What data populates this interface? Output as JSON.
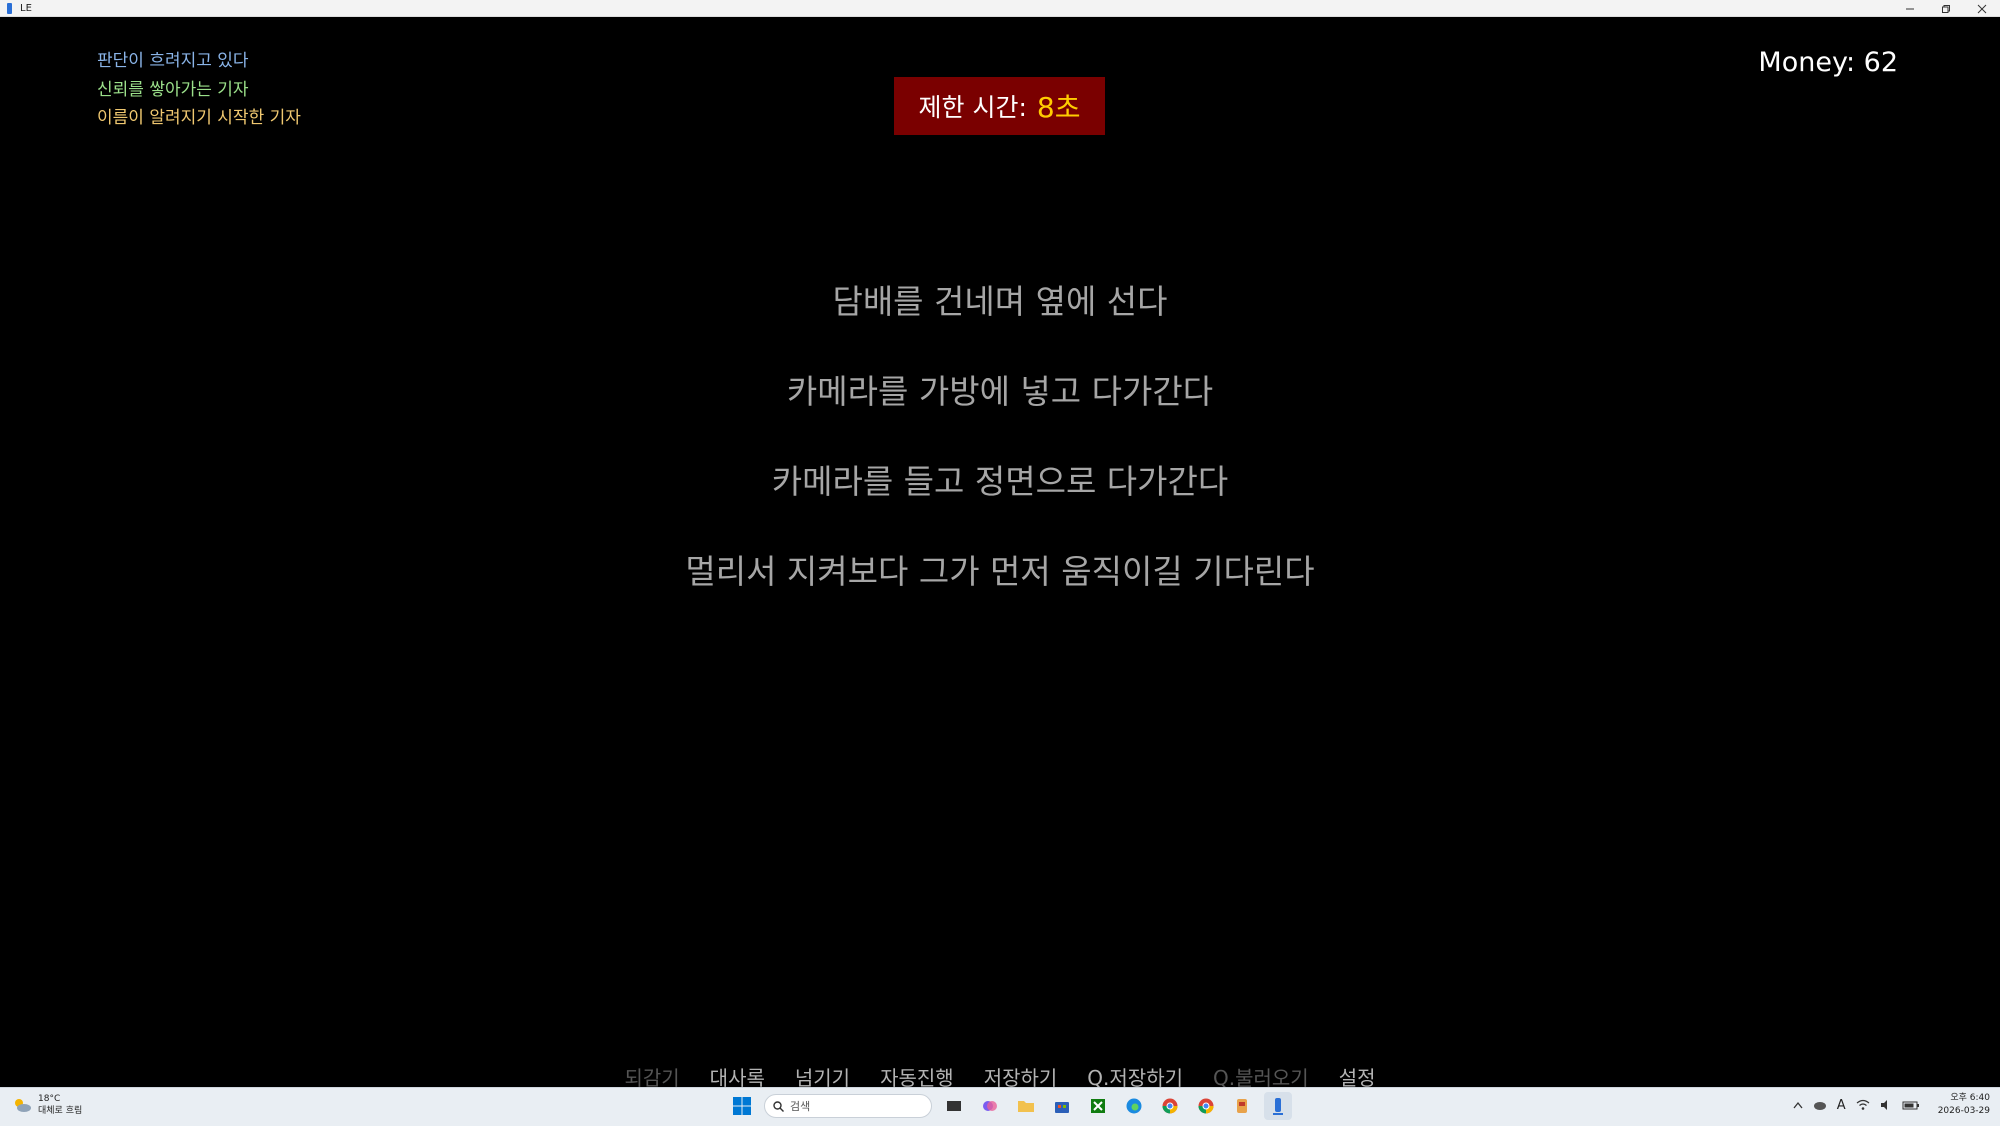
{
  "window": {
    "title": "LE"
  },
  "status_lines": [
    {
      "text": "판단이 흐려지고 있다",
      "color": "#8ab4e8"
    },
    {
      "text": "신뢰를 쌓아가는 기자",
      "color": "#9be08a"
    },
    {
      "text": "이름이 알려지기 시작한 기자",
      "color": "#f0c870"
    }
  ],
  "money": {
    "label": "Money: 62"
  },
  "timer": {
    "label": "제한 시간:",
    "value": "8초"
  },
  "choices": [
    "담배를 건네며 옆에 선다",
    "카메라를 가방에 넣고 다가간다",
    "카메라를 들고 정면으로 다가간다",
    "멀리서 지켜보다 그가 먼저 움직이길 기다린다"
  ],
  "quick_menu": [
    {
      "label": "되감기",
      "enabled": false
    },
    {
      "label": "대사록",
      "enabled": true
    },
    {
      "label": "넘기기",
      "enabled": true
    },
    {
      "label": "자동진행",
      "enabled": true
    },
    {
      "label": "저장하기",
      "enabled": true
    },
    {
      "label": "Q.저장하기",
      "enabled": true
    },
    {
      "label": "Q.불러오기",
      "enabled": false
    },
    {
      "label": "설정",
      "enabled": true
    }
  ],
  "taskbar": {
    "weather_temp": "18°C",
    "weather_desc": "대체로 흐림",
    "search_placeholder": "검색",
    "time": "오후 6:40",
    "date": "2026-03-29",
    "ime": "A"
  }
}
